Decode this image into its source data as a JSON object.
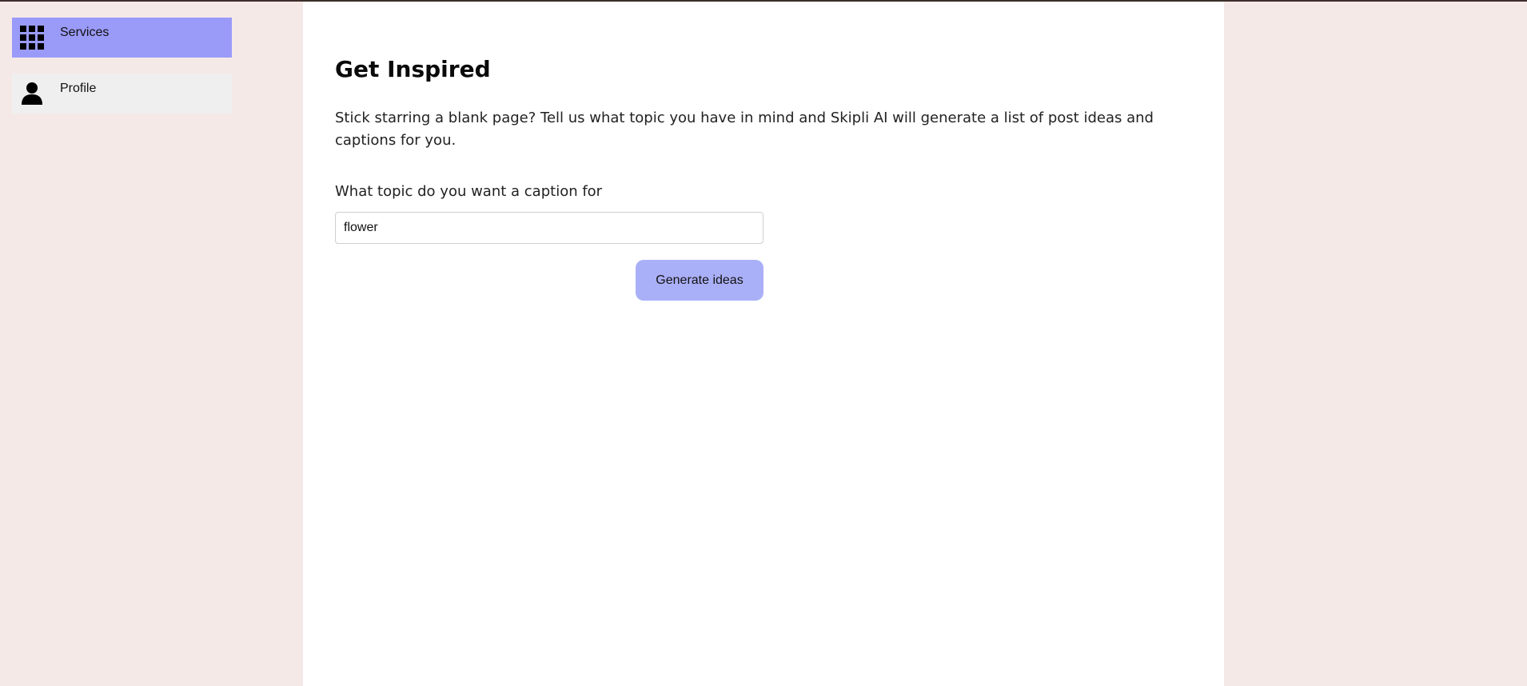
{
  "sidebar": {
    "items": [
      {
        "label": "Services",
        "icon": "grid-icon",
        "active": true
      },
      {
        "label": "Profile",
        "icon": "person-icon",
        "active": false
      }
    ]
  },
  "main": {
    "title": "Get Inspired",
    "description": "Stick starring a blank page? Tell us what topic you have in mind and Skipli AI will generate a list of post ideas and captions for you.",
    "topic_label": "What topic do you want a caption for",
    "topic_value": "flower",
    "generate_label": "Generate ideas"
  },
  "colors": {
    "page_background": "#f5e9e8",
    "panel_background": "#ffffff",
    "active_nav": "#9a9af8",
    "inactive_nav": "#efefef",
    "button": "#aab0f7"
  }
}
